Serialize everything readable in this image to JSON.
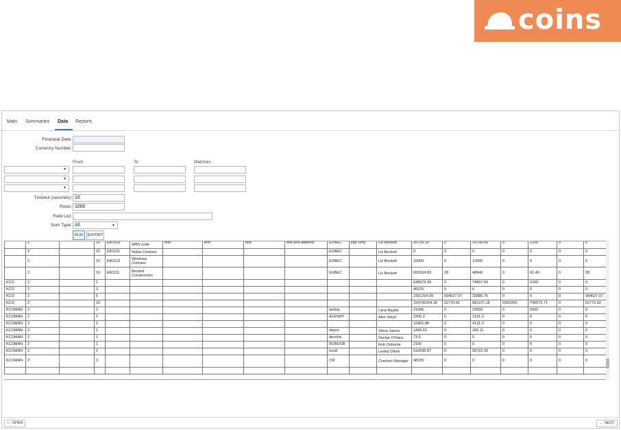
{
  "brand": {
    "name": "coins",
    "color": "#f08a55"
  },
  "tabs": [
    {
      "label": "Main",
      "active": false
    },
    {
      "label": "Summaries",
      "active": false
    },
    {
      "label": "Data",
      "active": true
    },
    {
      "label": "Reports",
      "active": false
    }
  ],
  "form": {
    "financial_date_label": "Financial Date:",
    "financial_date_value": "",
    "currency_number_label": "Currency Number:",
    "currency_number_value": "",
    "from_label": "From",
    "to_label": "To",
    "matches_label": "Matches",
    "timeout_label": "Timeout (seconds):",
    "timeout_value": "10",
    "rows_label": "Rows:",
    "rows_value": "1000",
    "field_list_label": "Field List:",
    "field_list_value": "",
    "sum_type_label": "Sum Type:",
    "sum_type_value": "All",
    "run_label": "RUN",
    "export_label": "EXPORT"
  },
  "grid": {
    "rows": [
      [
        "",
        "2",
        "",
        "10",
        "EB1003",
        "Contract with WBS code",
        "test",
        "test",
        "test",
        "test and address",
        "EUBEC",
        "kpb Smy",
        "Liz Beckett",
        "20739.19",
        "0",
        "19738.69",
        "0",
        "1100",
        "0",
        "0"
      ],
      [
        "",
        "2",
        "",
        "10",
        "EB1011",
        "Nokia Contract",
        "",
        "",
        "",
        "",
        "EUBEC",
        "",
        "Liz Beckett",
        "0",
        "0",
        "0",
        "0",
        "0",
        "0",
        "0"
      ],
      [
        "",
        "2",
        "",
        "10",
        "EB1012",
        "Windows Contract",
        "",
        "",
        "",
        "",
        "EUBEC",
        "",
        "Liz Beckett",
        "10000",
        "0",
        "10000",
        "0",
        "0",
        "0",
        "0"
      ],
      [
        "",
        "2",
        "",
        "10",
        "EB1111",
        "Beckett Construction",
        "",
        "",
        "",
        "",
        "EUBEC",
        "",
        "Liz Beckett",
        "691504.83",
        "28",
        "48946",
        "0",
        "61.46",
        "0",
        "28"
      ],
      [
        "KCO",
        "2",
        "",
        "1",
        "",
        "",
        "",
        "",
        "",
        "",
        "",
        "",
        "",
        "548975.09",
        "0",
        "74897.54",
        "0",
        "1000",
        "0",
        "0"
      ],
      [
        "KCO",
        "2",
        "",
        "3",
        "",
        "",
        "",
        "",
        "",
        "",
        "",
        "",
        "",
        "48225",
        "0",
        "0",
        "0",
        "0",
        "0",
        "0"
      ],
      [
        "KCO",
        "2",
        "",
        "5",
        "",
        "",
        "",
        "",
        "",
        "",
        "",
        "",
        "",
        "2351254.09",
        "994527.07",
        "32886.76",
        "0",
        "0",
        "0",
        "994527.07"
      ],
      [
        "KCO",
        "2",
        "",
        "10",
        "",
        "",
        "",
        "",
        "",
        "",
        "",
        "",
        "",
        "154736264.36",
        "52770.82",
        "881107.18",
        "5000200",
        "745572.71",
        "0",
        "52770.82"
      ],
      [
        "KCOMAN",
        "2",
        "",
        "1",
        "",
        "",
        "",
        "",
        "",
        "",
        "lanbay",
        "",
        "Lana Bayda",
        "21945",
        "0",
        "10550",
        "0",
        "5000",
        "0",
        "0"
      ],
      [
        "KCOMAN",
        "2",
        "",
        "1",
        "",
        "",
        "",
        "",
        "",
        "",
        "ALESMY",
        "",
        "Alex Smyrl",
        "2306.2",
        "0",
        "1321.2",
        "0",
        "0",
        "0",
        "0"
      ],
      [
        "KCOMAN",
        "2",
        "",
        "1",
        "",
        "",
        "",
        "",
        "",
        "",
        "",
        "",
        "",
        "10401.88",
        "0",
        "4121.2",
        "0",
        "0",
        "0",
        "0"
      ],
      [
        "KCOMAN",
        "2",
        "",
        "1",
        "",
        "",
        "",
        "",
        "",
        "",
        "stejon",
        "",
        "Steve James",
        "1499.62",
        "0",
        "183.11",
        "0",
        "0",
        "0",
        "0"
      ],
      [
        "KCOMAN",
        "2",
        "",
        "1",
        "",
        "",
        "",
        "",
        "",
        "",
        "decoha",
        "",
        "Declan O'Hara",
        "73.5",
        "0",
        "0",
        "0",
        "0",
        "0",
        "0"
      ],
      [
        "KCOMAN",
        "2",
        "",
        "1",
        "",
        "",
        "",
        "",
        "",
        "",
        "ROBOSB",
        "",
        "Rob Osborne",
        "2150",
        "0",
        "0",
        "0",
        "0",
        "0",
        "0"
      ],
      [
        "KCOMAN",
        "2",
        "",
        "1",
        "",
        "",
        "",
        "",
        "",
        "",
        "lesoli",
        "",
        "Lesley Oliver",
        "510598.87",
        "0",
        "58722.03",
        "0",
        "0",
        "0",
        "0"
      ],
      [
        "KCOMAN",
        "2",
        "",
        "3",
        "",
        "",
        "",
        "",
        "",
        "",
        "CM",
        "",
        "Contract Manager",
        "48225",
        "0",
        "0",
        "0",
        "0",
        "0",
        "0"
      ],
      [
        "",
        "",
        "",
        "",
        "",
        "",
        "",
        "",
        "",
        "",
        "",
        "",
        "",
        "",
        "",
        "",
        "",
        "",
        "",
        ""
      ]
    ]
  },
  "footer": {
    "open_label": "OPEN",
    "next_label": "NEXT"
  }
}
